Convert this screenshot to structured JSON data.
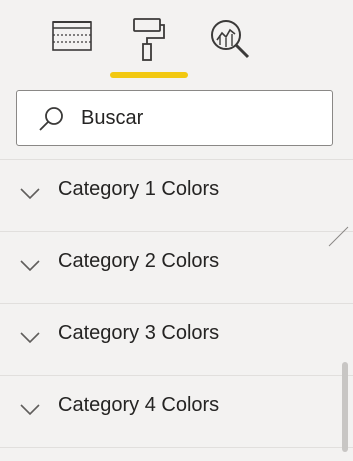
{
  "toolbar": {
    "tools": [
      {
        "icon": "fields-grid-icon",
        "active": false
      },
      {
        "icon": "paint-roller-icon",
        "active": true
      },
      {
        "icon": "analytics-magnifier-icon",
        "active": false
      }
    ],
    "active_underline_color": "#f2c811"
  },
  "search": {
    "placeholder": "Buscar",
    "value": "",
    "icon": "search-icon"
  },
  "sections": [
    {
      "label": "Category 1 Colors",
      "expanded": false
    },
    {
      "label": "Category 2 Colors",
      "expanded": false
    },
    {
      "label": "Category 3 Colors",
      "expanded": false
    },
    {
      "label": "Category 4 Colors",
      "expanded": false
    }
  ],
  "colors": {
    "background": "#f3f2f1",
    "text": "#252423",
    "divider": "#e1dfdd",
    "accent": "#f2c811"
  }
}
